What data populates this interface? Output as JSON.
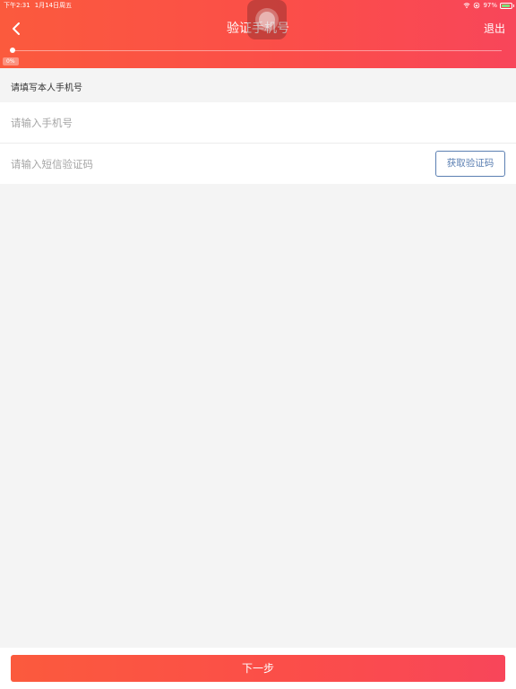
{
  "status_bar": {
    "time": "下午2:31",
    "date": "1月14日周五",
    "battery": "97%"
  },
  "header": {
    "title": "验证手机号",
    "exit_label": "退出",
    "progress": {
      "percent": 0,
      "label": "0%"
    }
  },
  "form": {
    "section_label": "请填写本人手机号",
    "phone": {
      "value": "",
      "placeholder": "请输入手机号"
    },
    "sms_code": {
      "value": "",
      "placeholder": "请输入短信验证码"
    },
    "get_code_label": "获取验证码"
  },
  "footer": {
    "next_label": "下一步"
  },
  "colors": {
    "accent": "#fb4d4a",
    "link_blue": "#5b7fb2",
    "page_bg": "#f4f4f4"
  }
}
